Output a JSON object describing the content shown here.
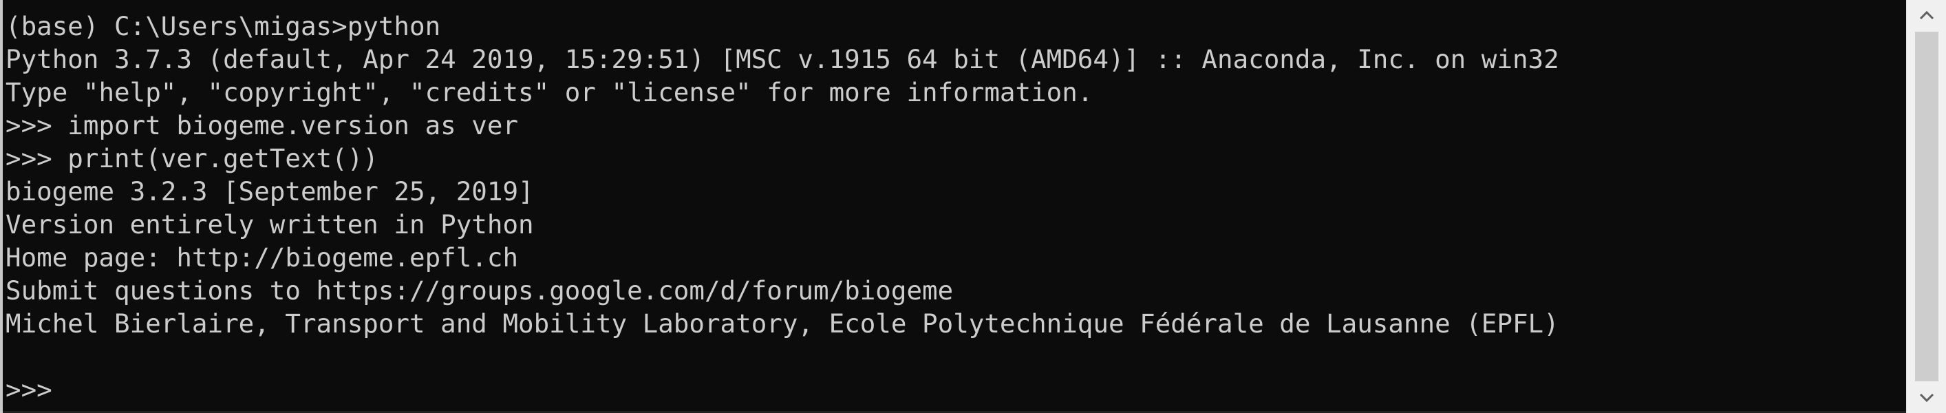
{
  "console": {
    "lines": [
      "(base) C:\\Users\\migas>python",
      "Python 3.7.3 (default, Apr 24 2019, 15:29:51) [MSC v.1915 64 bit (AMD64)] :: Anaconda, Inc. on win32",
      "Type \"help\", \"copyright\", \"credits\" or \"license\" for more information.",
      ">>> import biogeme.version as ver",
      ">>> print(ver.getText())",
      "biogeme 3.2.3 [September 25, 2019]",
      "Version entirely written in Python",
      "Home page: http://biogeme.epfl.ch",
      "Submit questions to https://groups.google.com/d/forum/biogeme",
      "Michel Bierlaire, Transport and Mobility Laboratory, Ecole Polytechnique Fédérale de Lausanne (EPFL)",
      "",
      ">>>"
    ]
  },
  "colors": {
    "background": "#0c0c0c",
    "text": "#cccccc",
    "scrollbar_track": "#f0f0f0",
    "scrollbar_thumb": "#cdcdcd",
    "scrollbar_arrow": "#606060"
  },
  "scrollbar": {
    "up_icon": "chevron-up-icon",
    "down_icon": "chevron-down-icon"
  }
}
